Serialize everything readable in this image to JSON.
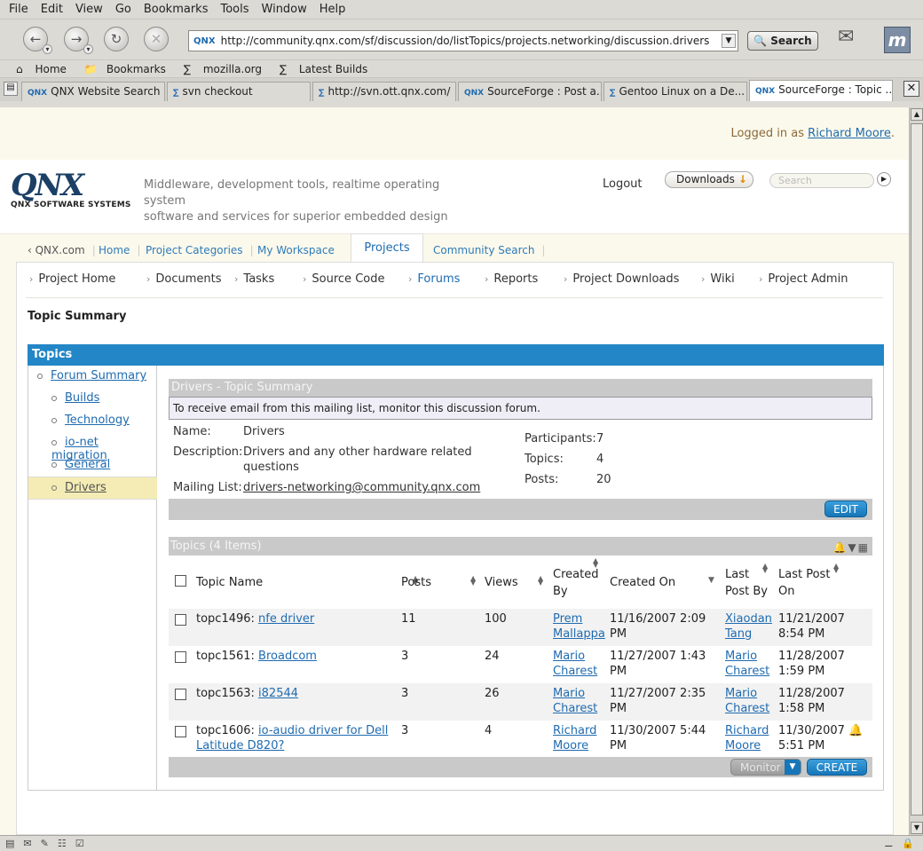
{
  "browser": {
    "menu": [
      "File",
      "Edit",
      "View",
      "Go",
      "Bookmarks",
      "Tools",
      "Window",
      "Help"
    ],
    "url": "http://community.qnx.com/sf/discussion/do/listTopics/projects.networking/discussion.drivers",
    "search_button": "Search",
    "bookmarks": [
      "Home",
      "Bookmarks",
      "mozilla.org",
      "Latest Builds"
    ],
    "tabs": [
      "QNX Website Search",
      "svn checkout",
      "http://svn.ott.qnx.com/",
      "SourceForge : Post a...",
      "Gentoo Linux on a De...",
      "SourceForge : Topic ..."
    ],
    "active_tab": 5
  },
  "page": {
    "login_prefix": "Logged in as ",
    "login_user": "Richard Moore",
    "login_suffix": ".",
    "logo_big": "QNX",
    "logo_small": "QNX SOFTWARE SYSTEMS",
    "tagline_1": "Middleware, development tools, realtime operating system",
    "tagline_2": "software and services for superior embedded design",
    "logout": "Logout",
    "downloads": "Downloads",
    "search_placeholder": "Search",
    "main_tabs": [
      "‹ QNX.com",
      "Home",
      "Project Categories",
      "My Workspace",
      "Projects",
      "Community Search"
    ],
    "sub_nav": [
      "Project Home",
      "Documents",
      "Tasks",
      "Source Code",
      "Forums",
      "Reports",
      "Project Downloads",
      "Wiki",
      "Project Admin"
    ],
    "section_title": "Topic Summary",
    "topics_header": "Topics",
    "forums": [
      "Forum Summary",
      "Builds",
      "Technology",
      "io-net migration",
      "General",
      "Drivers"
    ],
    "summary": {
      "title": "Drivers - Topic Summary",
      "monitor_msg": "To receive email from this mailing list, monitor this discussion forum.",
      "name_label": "Name:",
      "name": "Drivers",
      "desc_label": "Description:",
      "desc_1": "Drivers and any other hardware related",
      "desc_2": "questions",
      "ml_label": "Mailing List:",
      "mailing_list": "drivers-networking@community.qnx.com",
      "participants_label": "Participants:",
      "participants": "7",
      "topics_label": "Topics:",
      "topics": "4",
      "posts_label": "Posts:",
      "posts": "20",
      "edit": "EDIT"
    },
    "topics_table": {
      "title": "Topics (4 Items)",
      "headers": {
        "name": "Topic Name",
        "posts": "Posts",
        "views": "Views",
        "created_by_1": "Created",
        "created_by_2": "By",
        "created_on": "Created On",
        "last_by_1": "Last",
        "last_by_2": "Post By",
        "last_on_1": "Last Post",
        "last_on_2": "On"
      },
      "rows": [
        {
          "id": "topc1496: ",
          "name": "nfe driver",
          "name2": "",
          "posts": "11",
          "views": "100",
          "cb1": "Prem",
          "cb2": "Mallappa",
          "co1": "11/16/2007 2:09",
          "co2": "PM",
          "lb1": "Xiaodan",
          "lb2": "Tang",
          "lo1": "11/21/2007",
          "lo2": "8:54 PM"
        },
        {
          "id": "topc1561: ",
          "name": "Broadcom",
          "name2": "",
          "posts": "3",
          "views": "24",
          "cb1": "Mario",
          "cb2": "Charest",
          "co1": "11/27/2007 1:43",
          "co2": "PM",
          "lb1": "Mario",
          "lb2": "Charest",
          "lo1": "11/28/2007",
          "lo2": "1:59 PM"
        },
        {
          "id": "topc1563: ",
          "name": "i82544",
          "name2": "",
          "posts": "3",
          "views": "26",
          "cb1": "Mario",
          "cb2": "Charest",
          "co1": "11/27/2007 2:35",
          "co2": "PM",
          "lb1": "Mario",
          "lb2": "Charest",
          "lo1": "11/28/2007",
          "lo2": "1:58 PM"
        },
        {
          "id": "topc1606: ",
          "name": "io-audio driver for Dell",
          "name2": "Latitude D820?",
          "posts": "3",
          "views": "4",
          "cb1": "Richard",
          "cb2": "Moore",
          "co1": "11/30/2007 5:44",
          "co2": "PM",
          "lb1": "Richard",
          "lb2": "Moore",
          "lo1": "11/30/2007",
          "lo2": "5:51 PM"
        }
      ],
      "monitor": "Monitor",
      "create": "CREATE"
    }
  }
}
